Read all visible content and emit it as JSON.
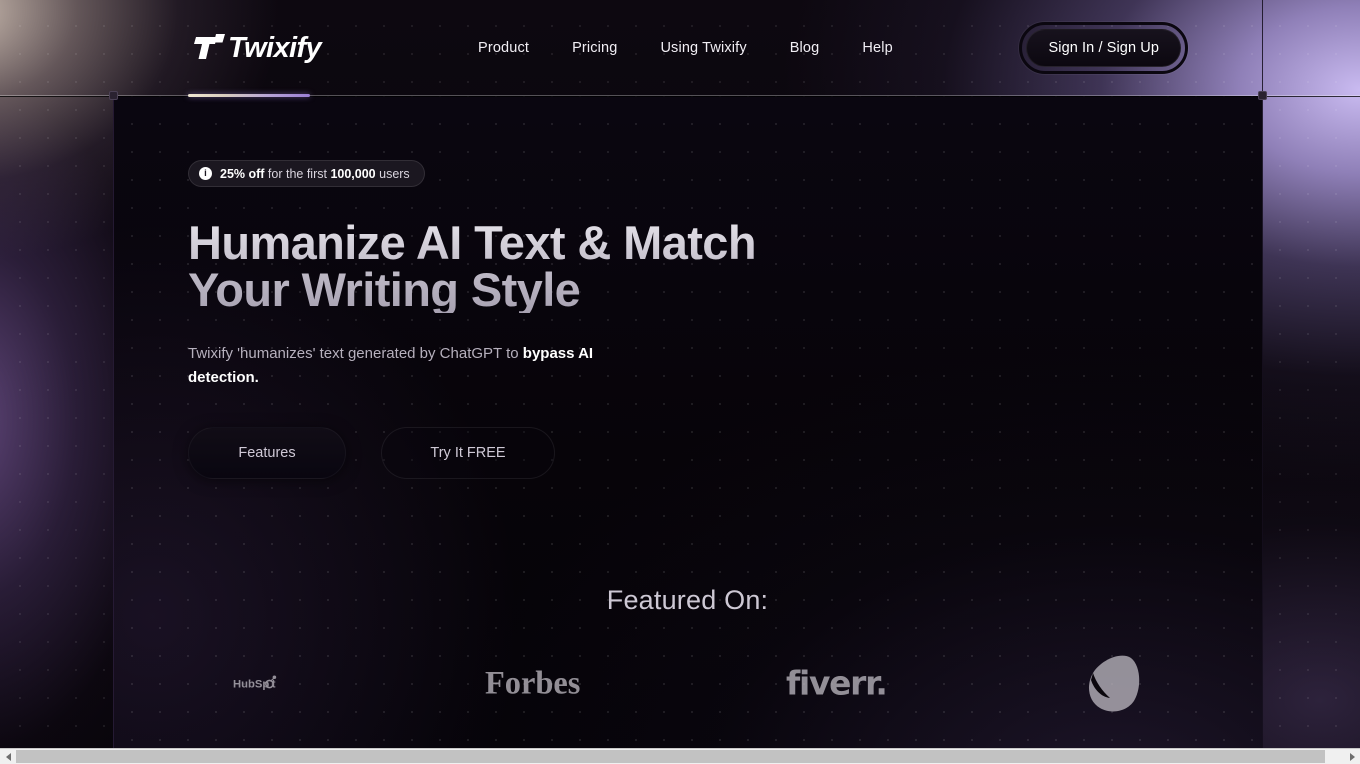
{
  "header": {
    "logo_text": "Twixify",
    "logo_icon": "twixify-t-mark",
    "nav": [
      {
        "label": "Product"
      },
      {
        "label": "Pricing"
      },
      {
        "label": "Using Twixify"
      },
      {
        "label": "Blog"
      },
      {
        "label": "Help"
      }
    ],
    "signin_label": "Sign In / Sign Up"
  },
  "hero": {
    "badge": {
      "icon": "info-icon",
      "discount": "25% off",
      "middle": " for the first ",
      "count": "100,000",
      "tail": " users"
    },
    "headline": "Humanize AI Text & Match Your Writing Style",
    "subhead_lead": "Twixify 'humanizes' text generated by ChatGPT to ",
    "subhead_bold": "bypass AI detection.",
    "cta_primary": "Features",
    "cta_secondary": "Try It FREE"
  },
  "featured": {
    "title": "Featured On:",
    "brands": [
      {
        "name": "HubSpot",
        "icon": "hubspot-logo"
      },
      {
        "name": "Forbes",
        "icon": "forbes-logo"
      },
      {
        "name": "fiverr.",
        "icon": "fiverr-logo"
      },
      {
        "name": "Entrepreneur",
        "icon": "entrepreneur-logo"
      }
    ]
  },
  "colors": {
    "accent_purple": "#9b7fd4",
    "accent_cream": "#efe6d2",
    "page_background": "#070409",
    "text_primary": "#ffffff",
    "text_muted": "#b6b0bd"
  },
  "scrollbar": {
    "left_arrow": "scroll-left-arrow",
    "right_arrow": "scroll-right-arrow"
  }
}
